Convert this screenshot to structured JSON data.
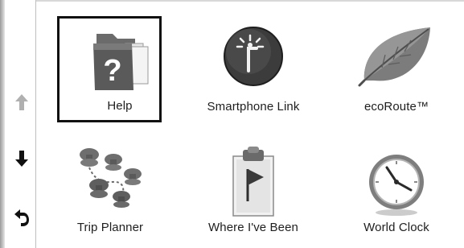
{
  "colors": {
    "background": "#ffffff",
    "text": "#1e1e1e",
    "selection_border": "#111111",
    "icon_dark": "#4a4a4a",
    "icon_mid": "#8c8c8c",
    "nav_disabled": "#b0b0b0"
  },
  "nav": {
    "up": {
      "icon": "arrow-up-icon",
      "enabled": false
    },
    "down": {
      "icon": "arrow-down-icon",
      "enabled": true
    },
    "back": {
      "icon": "back-icon",
      "enabled": true
    }
  },
  "tiles": [
    {
      "label": "Help",
      "icon": "help-folder-icon",
      "selected": true
    },
    {
      "label": "Smartphone Link",
      "icon": "smartphone-link-icon",
      "selected": false
    },
    {
      "label": "ecoRoute™",
      "icon": "leaf-icon",
      "selected": false
    },
    {
      "label": "Trip Planner",
      "icon": "pushpins-icon",
      "selected": false
    },
    {
      "label": "Where I've Been",
      "icon": "flag-clipboard-icon",
      "selected": false
    },
    {
      "label": "World Clock",
      "icon": "clock-icon",
      "selected": false
    }
  ]
}
